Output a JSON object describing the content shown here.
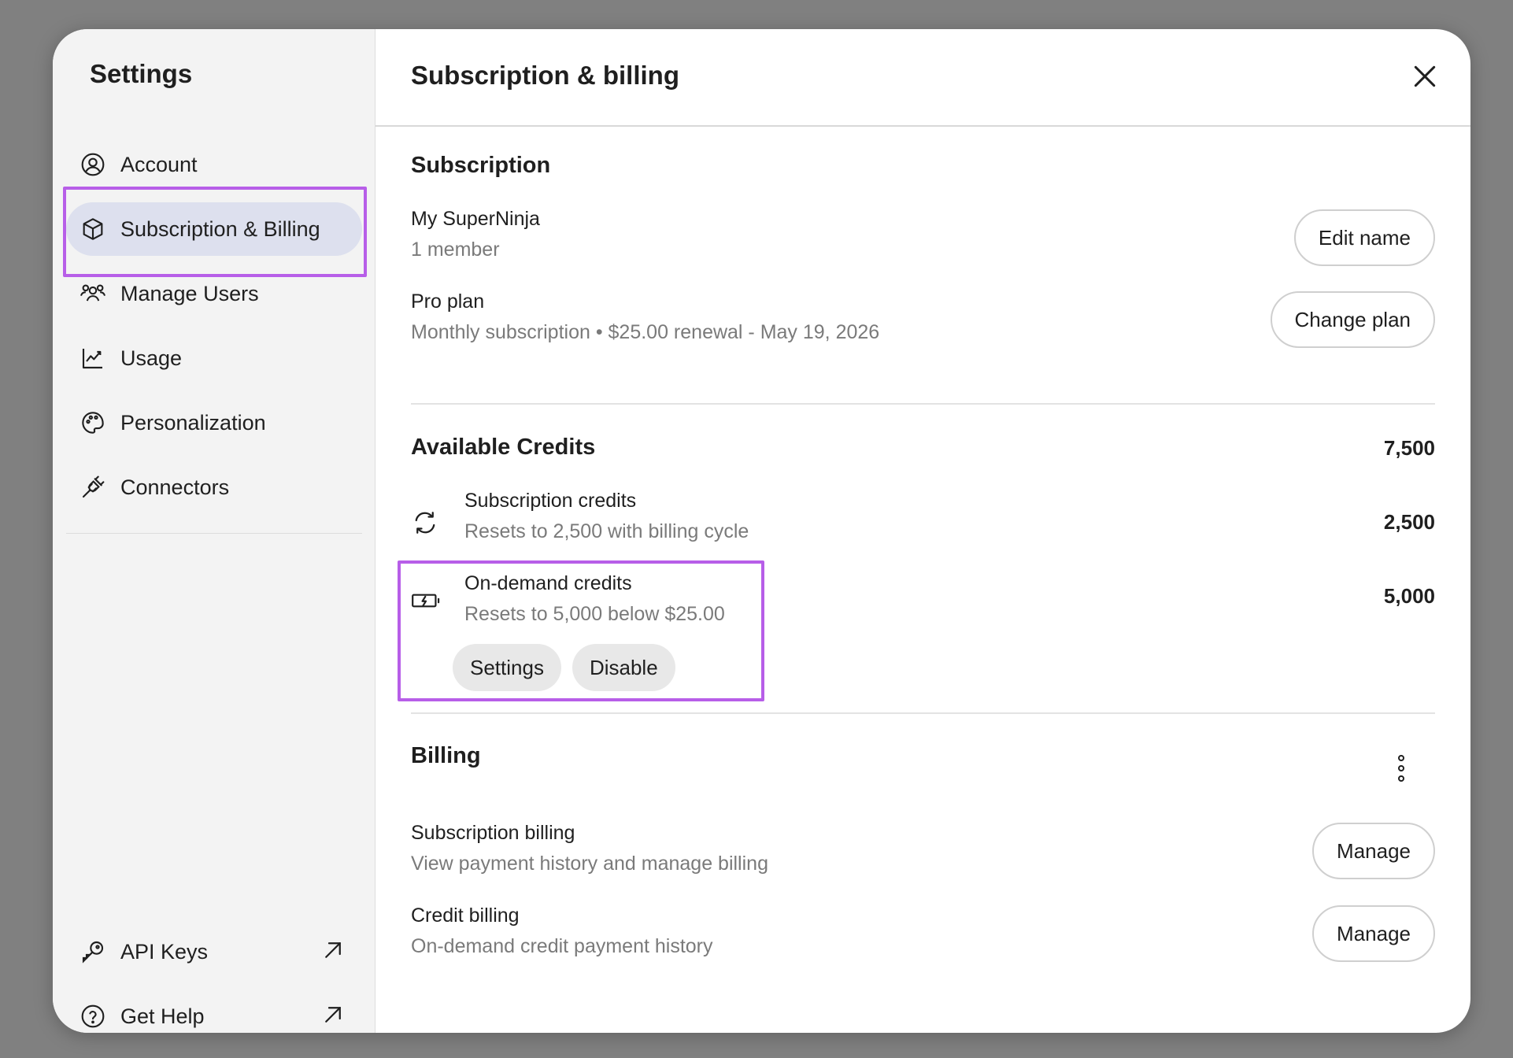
{
  "sidebar": {
    "title": "Settings",
    "items": [
      {
        "label": "Account",
        "icon": "user-circle-icon"
      },
      {
        "label": "Subscription & Billing",
        "icon": "package-icon",
        "active": true
      },
      {
        "label": "Manage Users",
        "icon": "users-icon"
      },
      {
        "label": "Usage",
        "icon": "chart-line-icon"
      },
      {
        "label": "Personalization",
        "icon": "palette-icon"
      },
      {
        "label": "Connectors",
        "icon": "plug-icon"
      }
    ],
    "bottom_items": [
      {
        "label": "API Keys",
        "icon": "key-icon",
        "external": true
      },
      {
        "label": "Get Help",
        "icon": "help-circle-icon",
        "external": true
      }
    ]
  },
  "header": {
    "title": "Subscription & billing"
  },
  "subscription": {
    "title": "Subscription",
    "workspace_name": "My SuperNinja",
    "workspace_members": "1 member",
    "edit_name_label": "Edit name",
    "plan_name": "Pro plan",
    "plan_details": "Monthly subscription • $25.00 renewal - May 19, 2026",
    "change_plan_label": "Change plan"
  },
  "credits": {
    "title": "Available Credits",
    "total": "7,500",
    "subscription_credits": {
      "title": "Subscription credits",
      "subtitle": "Resets to 2,500 with billing cycle",
      "value": "2,500"
    },
    "on_demand_credits": {
      "title": "On-demand credits",
      "subtitle": "Resets to 5,000 below $25.00",
      "value": "5,000",
      "settings_label": "Settings",
      "disable_label": "Disable"
    }
  },
  "billing": {
    "title": "Billing",
    "subscription_billing": {
      "title": "Subscription billing",
      "subtitle": "View payment history and manage billing",
      "button_label": "Manage"
    },
    "credit_billing": {
      "title": "Credit billing",
      "subtitle": "On-demand credit payment history",
      "button_label": "Manage"
    }
  },
  "colors": {
    "highlight": "#b75ee8",
    "active_nav": "#dde0ee",
    "sidebar_bg": "#f3f3f3"
  }
}
